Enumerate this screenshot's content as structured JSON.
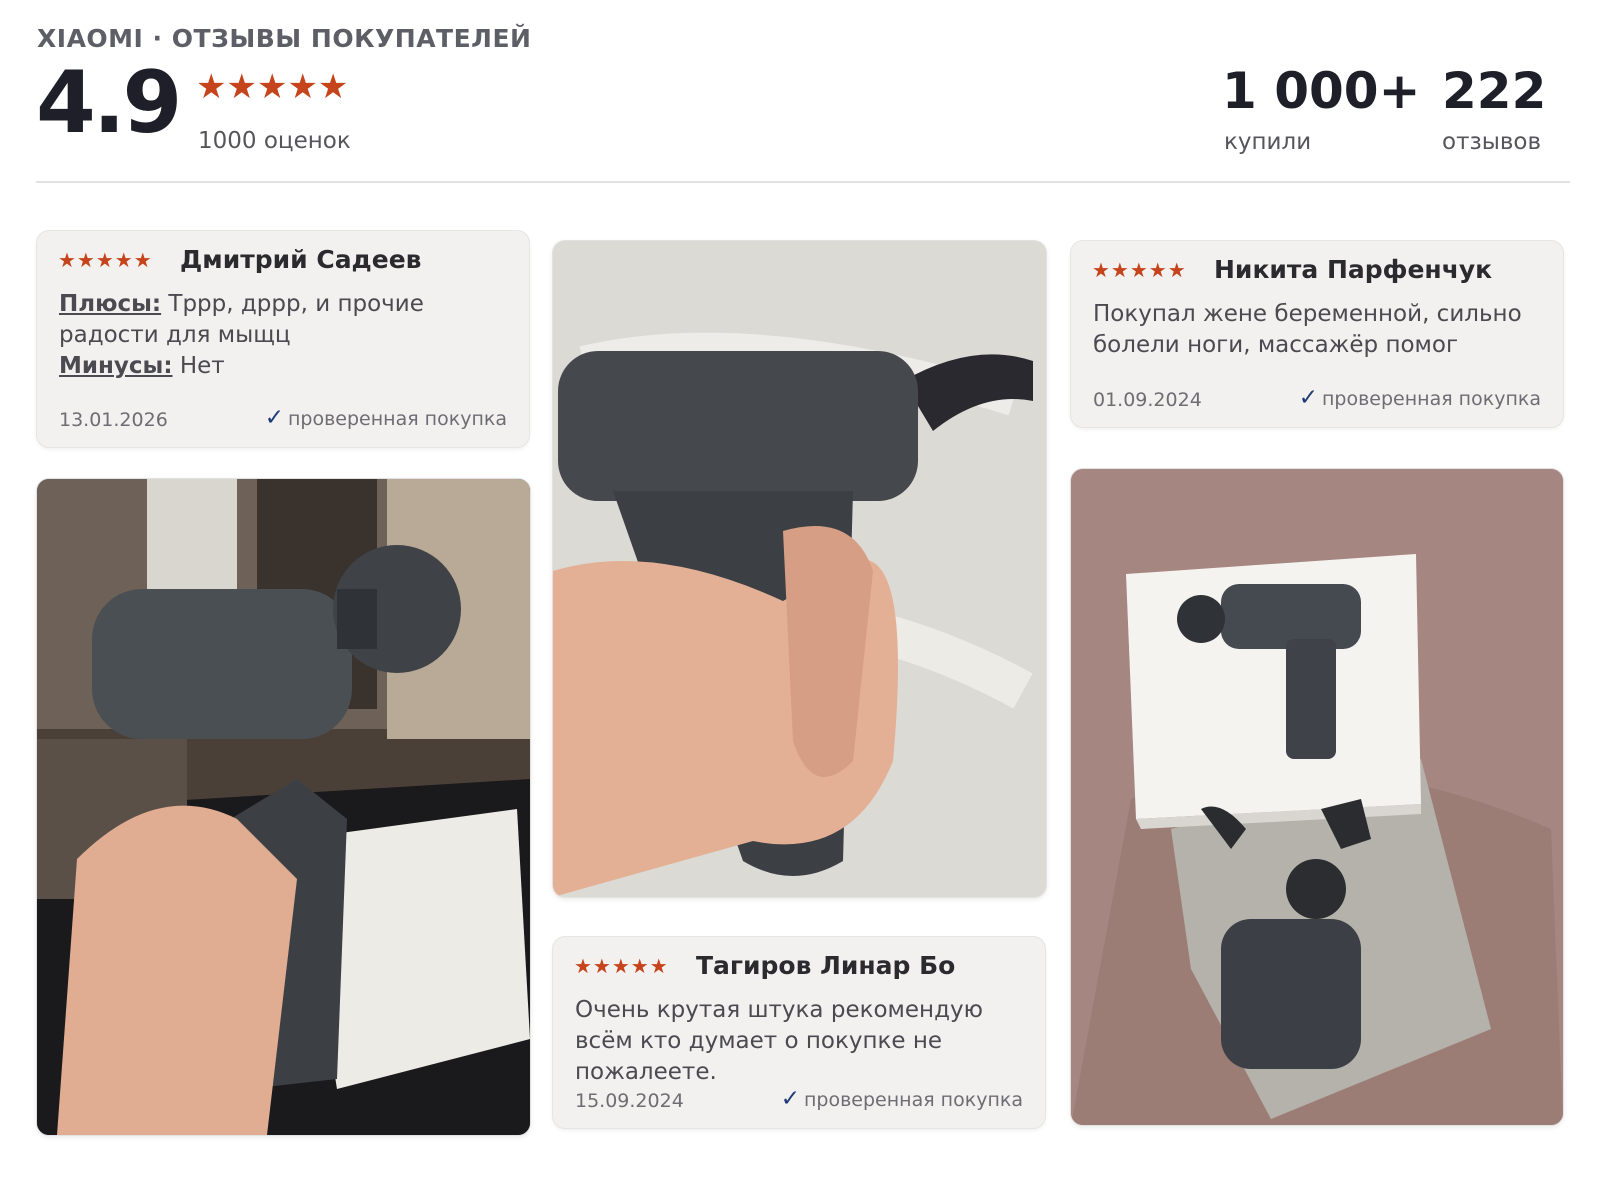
{
  "header": {
    "brand": "XIAOMI · ОТЗЫВЫ ПОКУПАТЕЛЕЙ",
    "rating": "4.9",
    "stars": "★★★★★",
    "ratings_count": "1000 оценок",
    "bought_value": "1 000+",
    "bought_label": "купили",
    "reviews_value": "222",
    "reviews_label": "отзывов"
  },
  "reviews": [
    {
      "stars": "★★★★★",
      "author": "Дмитрий Садеев",
      "pros_label": "Плюсы:",
      "pros": " Тррр, дррр, и прочие радости для мыщц",
      "cons_label": "Минусы:",
      "cons": " Нет",
      "date": "13.01.2026",
      "verified": "проверенная покупка"
    },
    {
      "stars": "★★★★★",
      "author": "Тагиров Линар Бо",
      "text": "Очень крутая штука рекомендую всём кто думает о покупке не пожалеете.",
      "date": "15.09.2024",
      "verified": "проверенная покупка"
    },
    {
      "stars": "★★★★★",
      "author": "Никита Парфенчук",
      "text": "Покупал жене беременной, сильно болели ноги, массажёр помог",
      "date": "01.09.2024",
      "verified": "проверенная покупка"
    }
  ],
  "icons": {
    "check": "✓"
  },
  "colors": {
    "star": "#c5441c",
    "check": "#1f3a78",
    "card_bg": "#f2f1ef"
  }
}
